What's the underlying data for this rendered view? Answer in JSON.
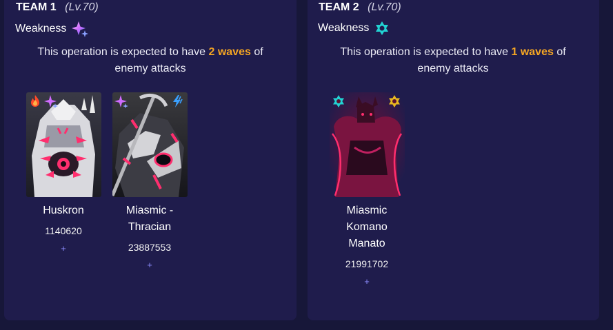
{
  "teams": [
    {
      "name": "TEAM 1",
      "level": "(Lv.70)",
      "weakness_label": "Weakness",
      "weakness_icon": "imaginary-sparkle-icon",
      "waves_prefix": "This operation is expected to have ",
      "waves_highlight": "2 waves",
      "waves_suffix": " of enemy attacks",
      "enemies": [
        {
          "name": "Huskron",
          "hp": "1140620",
          "add": "+",
          "badges": [
            "fire-icon",
            "imaginary-sparkle-icon"
          ]
        },
        {
          "name": "Miasmic - Thracian",
          "hp": "23887553",
          "add": "+",
          "badges": [
            "imaginary-sparkle-icon",
            "lightning-icon"
          ]
        }
      ]
    },
    {
      "name": "TEAM 2",
      "level": "(Lv.70)",
      "weakness_label": "Weakness",
      "weakness_icon": "quantum-star-icon",
      "waves_prefix": "This operation is expected to have ",
      "waves_highlight": "1 waves",
      "waves_suffix": " of enemy attacks",
      "enemies": [
        {
          "name": "Miasmic Komano Manato",
          "hp": "21991702",
          "add": "+",
          "badges": [
            "quantum-star-icon",
            "gold-star-icon"
          ]
        }
      ]
    }
  ],
  "colors": {
    "background": "#171739",
    "panel": "#1f1c4c",
    "highlight": "#f5a623",
    "add": "#8d8dff",
    "imaginary": "#c77dff",
    "quantum": "#22d3d3"
  }
}
